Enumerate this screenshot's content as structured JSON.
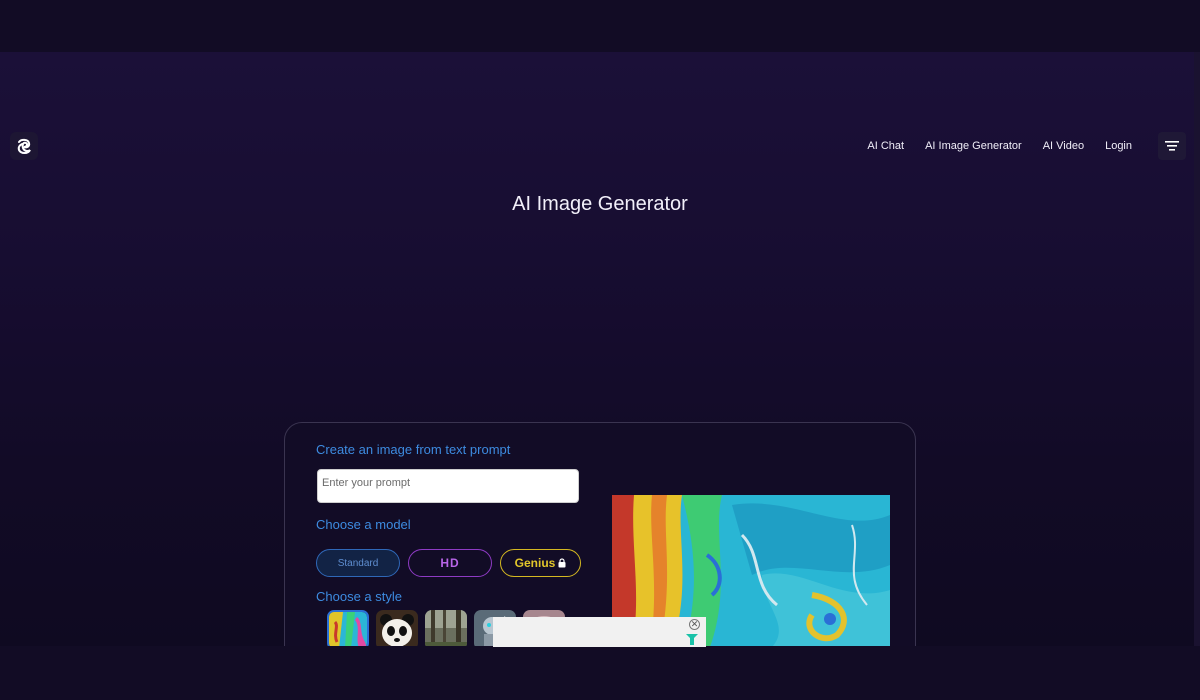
{
  "header": {
    "logo_icon": "swirl-logo-icon",
    "nav": [
      {
        "label": "AI Chat"
      },
      {
        "label": "AI Image Generator"
      },
      {
        "label": "AI Video"
      },
      {
        "label": "Login"
      }
    ],
    "menu_icon": "hamburger-menu-icon"
  },
  "page": {
    "title": "AI Image Generator"
  },
  "generator": {
    "prompt_label": "Create an image from text prompt",
    "prompt_placeholder": "Enter your prompt",
    "model_label": "Choose a model",
    "models": [
      {
        "label": "Standard",
        "selected": true
      },
      {
        "label": "HD",
        "selected": false
      },
      {
        "label": "Genius",
        "locked": true,
        "selected": false
      }
    ],
    "style_label": "Choose a style",
    "styles_icons": [
      "abstract-paint-thumb",
      "panda-thumb",
      "forest-thumb",
      "robot-thumb",
      "pink-thumb"
    ]
  },
  "ad": {
    "close_icon": "close-icon"
  },
  "colors": {
    "accent_blue": "#3d8be0",
    "hd_purple": "#b865e8",
    "genius_gold": "#e2c62b",
    "background": "#0f0a21"
  }
}
